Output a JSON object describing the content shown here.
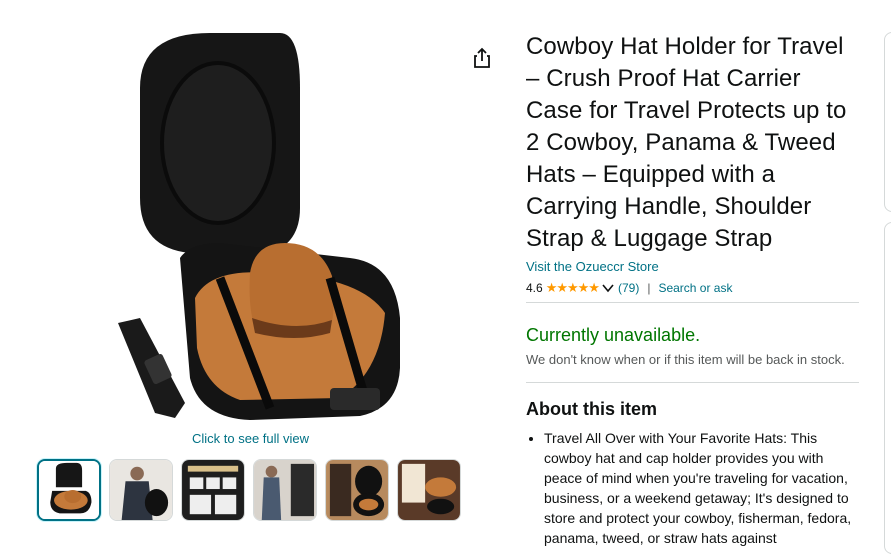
{
  "share": {
    "icon": "share-icon"
  },
  "gallery": {
    "full_view_link": "Click to see full view",
    "thumbnails": [
      {
        "label": "thumb-hat-case"
      },
      {
        "label": "thumb-man-with-case"
      },
      {
        "label": "thumb-accessories"
      },
      {
        "label": "thumb-carrying"
      },
      {
        "label": "thumb-case-open"
      },
      {
        "label": "thumb-hat-sizes"
      }
    ]
  },
  "product": {
    "title": "Cowboy Hat Holder for Travel – Crush Proof Hat Carrier Case for Travel Protects up to 2 Cowboy, Panama & Tweed Hats – Equipped with a Carrying Handle, Shoulder Strap & Luggage Strap",
    "store_link": "Visit the Ozueccr Store",
    "rating": "4.6",
    "stars": "★★★★★",
    "review_count": "(79)",
    "separator": "|",
    "search_ask": "Search or ask",
    "availability": "Currently unavailable.",
    "availability_note": "We don't know when or if this item will be back in stock.",
    "about_heading": "About this item",
    "bullets": [
      "Travel All Over with Your Favorite Hats: This cowboy hat and cap holder provides you with peace of mind when you're traveling for vacation, business, or a weekend getaway; It's designed to store and protect your cowboy, fisherman, fedora, panama, tweed, or straw hats against"
    ]
  },
  "colors": {
    "link": "#007185",
    "available": "#007600",
    "star": "#ff9900"
  }
}
